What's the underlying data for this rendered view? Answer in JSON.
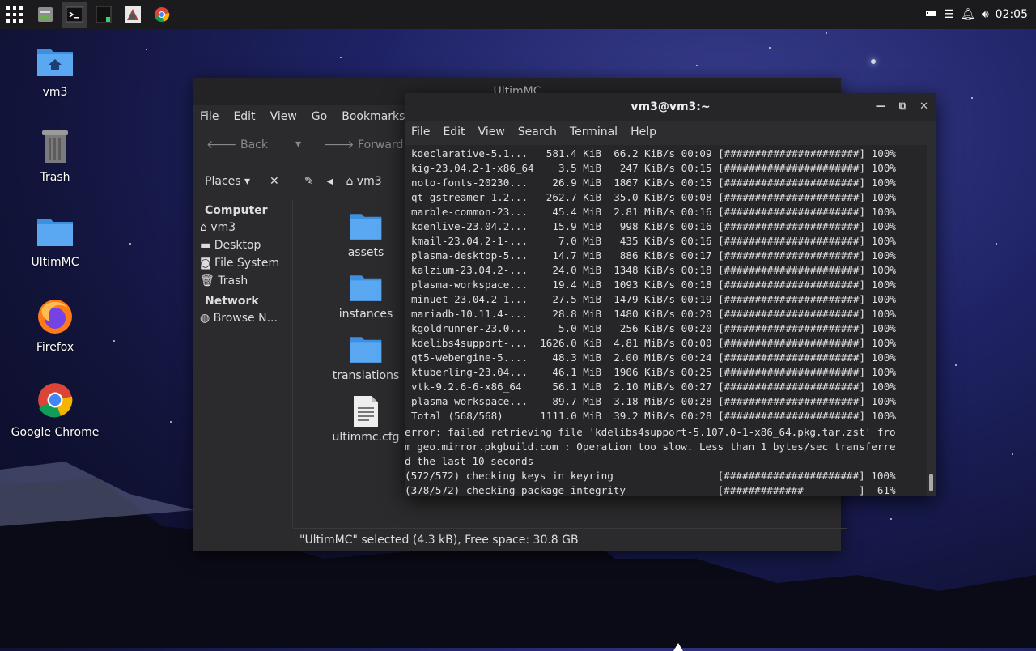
{
  "panel": {
    "clock": "02:05"
  },
  "desktop_icons": [
    {
      "label": "vm3"
    },
    {
      "label": "Trash"
    },
    {
      "label": "UltimMC"
    },
    {
      "label": "Firefox"
    },
    {
      "label": "Google Chrome"
    }
  ],
  "fm": {
    "title": "UltimMC",
    "menu": [
      "File",
      "Edit",
      "View",
      "Go",
      "Bookmarks"
    ],
    "back": "Back",
    "forward": "Forward",
    "places": "Places",
    "path_home": "vm3",
    "sidebar": {
      "computer": "Computer",
      "items": [
        "vm3",
        "Desktop",
        "File System",
        "Trash"
      ],
      "network": "Network",
      "browse": "Browse N..."
    },
    "files": [
      "assets",
      "instances",
      "translations",
      "ultimmc.cfg"
    ],
    "status": "\"UltimMC\" selected (4.3 kB), Free space: 30.8 GB"
  },
  "terminal": {
    "title": "vm3@vm3:~",
    "menu": [
      "File",
      "Edit",
      "View",
      "Search",
      "Terminal",
      "Help"
    ],
    "lines": [
      "kdeclarative-5.1...   581.4 KiB  66.2 KiB/s 00:09 [######################] 100%",
      "kig-23.04.2-1-x86_64    3.5 MiB   247 KiB/s 00:15 [######################] 100%",
      "noto-fonts-20230...    26.9 MiB  1867 KiB/s 00:15 [######################] 100%",
      "qt-gstreamer-1.2...   262.7 KiB  35.0 KiB/s 00:08 [######################] 100%",
      "marble-common-23...    45.4 MiB  2.81 MiB/s 00:16 [######################] 100%",
      "kdenlive-23.04.2...    15.9 MiB   998 KiB/s 00:16 [######################] 100%",
      "kmail-23.04.2-1-...     7.0 MiB   435 KiB/s 00:16 [######################] 100%",
      "plasma-desktop-5...    14.7 MiB   886 KiB/s 00:17 [######################] 100%",
      "kalzium-23.04.2-...    24.0 MiB  1348 KiB/s 00:18 [######################] 100%",
      "plasma-workspace...    19.4 MiB  1093 KiB/s 00:18 [######################] 100%",
      "minuet-23.04.2-1...    27.5 MiB  1479 KiB/s 00:19 [######################] 100%",
      "mariadb-10.11.4-...    28.8 MiB  1480 KiB/s 00:20 [######################] 100%",
      "kgoldrunner-23.0...     5.0 MiB   256 KiB/s 00:20 [######################] 100%",
      "kdelibs4support-...  1626.0 KiB  4.81 MiB/s 00:00 [######################] 100%",
      "qt5-webengine-5....    48.3 MiB  2.00 MiB/s 00:24 [######################] 100%",
      "ktuberling-23.04...    46.1 MiB  1906 KiB/s 00:25 [######################] 100%",
      "vtk-9.2.6-6-x86_64     56.1 MiB  2.10 MiB/s 00:27 [######################] 100%",
      "plasma-workspace...    89.7 MiB  3.18 MiB/s 00:28 [######################] 100%",
      "Total (568/568)      1111.0 MiB  39.2 MiB/s 00:28 [######################] 100%"
    ],
    "error_lines": [
      "error: failed retrieving file 'kdelibs4support-5.107.0-1-x86_64.pkg.tar.zst' fro",
      "m geo.mirror.pkgbuild.com : Operation too slow. Less than 1 bytes/sec transferre",
      "d the last 10 seconds",
      "(572/572) checking keys in keyring                 [######################] 100%",
      "(378/572) checking package integrity               [#############---------]  61%"
    ]
  }
}
